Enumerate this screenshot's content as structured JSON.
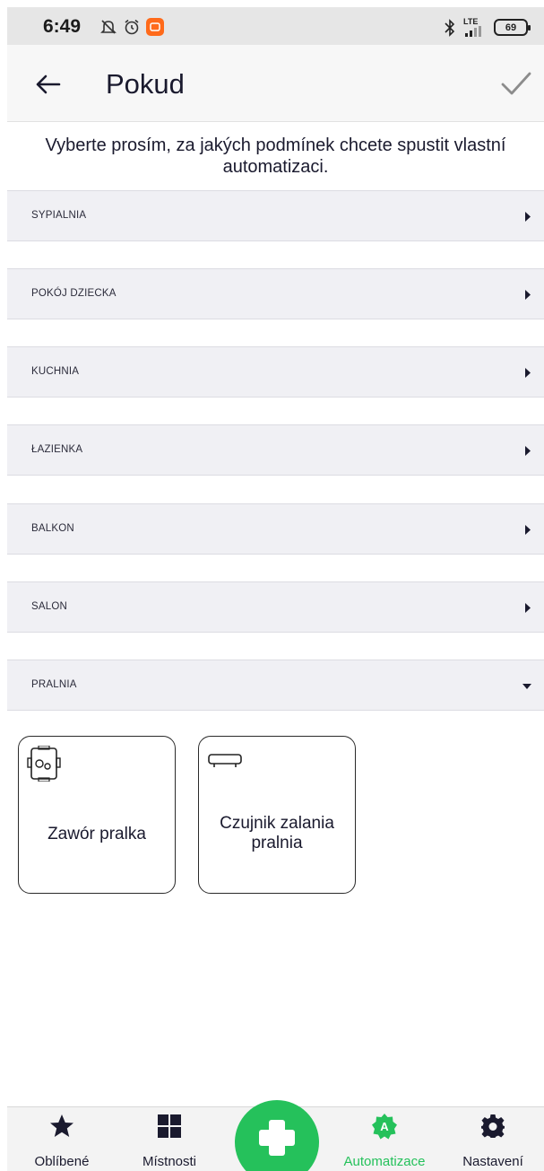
{
  "status_bar": {
    "time": "6:49",
    "battery": "69",
    "network": "LTE"
  },
  "header": {
    "title": "Pokud",
    "back_icon": "arrow-left-icon",
    "confirm_icon": "check-icon"
  },
  "intro_text": "Vyberte prosím, za jakých podmínek chcete spustit vlastní automatizaci.",
  "rooms": [
    {
      "label": "SYPIALNIA",
      "expanded": false
    },
    {
      "label": "POKÓJ DZIECKA",
      "expanded": false
    },
    {
      "label": "KUCHNIA",
      "expanded": false
    },
    {
      "label": "ŁAZIENKA",
      "expanded": false
    },
    {
      "label": "BALKON",
      "expanded": false
    },
    {
      "label": "SALON",
      "expanded": false
    },
    {
      "label": "PRALNIA",
      "expanded": true
    }
  ],
  "devices": [
    {
      "name": "Zawór pralka",
      "icon": "valve-icon"
    },
    {
      "name": "Czujnik zalania pralnia",
      "icon": "flood-sensor-icon"
    }
  ],
  "bottom_nav": {
    "items": [
      {
        "label": "Oblíbené",
        "icon": "star-icon",
        "active": false
      },
      {
        "label": "Místnosti",
        "icon": "grid-icon",
        "active": false
      },
      {
        "label": "Automatizace",
        "icon": "automation-icon",
        "active": true
      },
      {
        "label": "Nastavení",
        "icon": "gear-icon",
        "active": false
      }
    ],
    "fab_icon": "plus-icon"
  },
  "colors": {
    "accent": "#25c15b",
    "room_bg": "#f0f0f4",
    "text": "#1a1a2e"
  }
}
